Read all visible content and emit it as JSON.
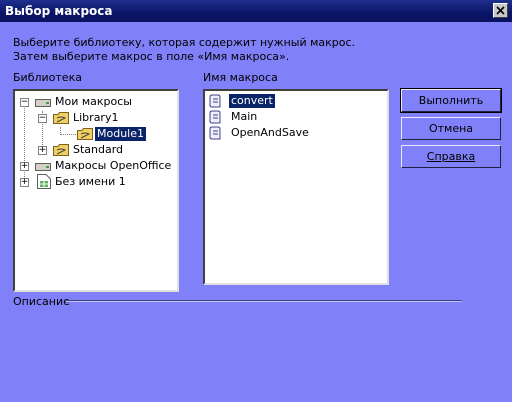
{
  "window": {
    "title": "Выбор макроса"
  },
  "description": "Выберите библиотеку, которая содержит нужный макрос. Затем выберите макрос в поле «Имя макроса».",
  "library_label": "Библиотека",
  "macro_label": "Имя макроса",
  "library_tree": {
    "my_macros": "Мои макросы",
    "library1": "Library1",
    "module1": "Module1",
    "standard": "Standard",
    "openoffice": "Макросы OpenOffice",
    "untitled": "Без имени 1"
  },
  "macros": [
    "convert",
    "Main",
    "OpenAndSave"
  ],
  "buttons": {
    "run": "Выполнить",
    "cancel": "Отмена",
    "help": "Справка"
  },
  "description_section": "Описание",
  "colors": {
    "background": "#8080f8",
    "titlebar": "#0b1466",
    "selection": "#0a246a"
  }
}
